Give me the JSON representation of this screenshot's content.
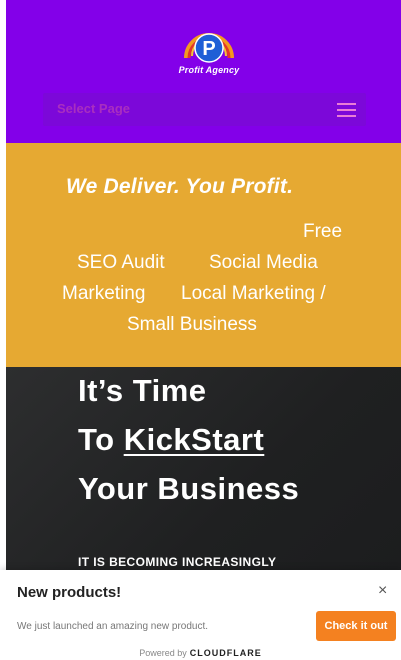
{
  "header": {
    "logo_text": "Profit Agency",
    "logo_letter": "P",
    "menu_placeholder": "Select Page"
  },
  "hero_band": {
    "tagline": "We Deliver. You Profit.",
    "services": [
      "Free",
      "SEO Audit",
      "Social Media",
      "Marketing",
      "Local Marketing /",
      "Small Business"
    ]
  },
  "hero": {
    "line1": "It’s Time",
    "line2_prefix": "To ",
    "line2_link": "KickStart",
    "line3": "Your Business",
    "subtext": "IT IS BECOMING INCREASINGLY"
  },
  "notification": {
    "title": "New products!",
    "message": "We just launched an amazing new product.",
    "cta_label": "Check it out",
    "close_glyph": "×",
    "powered_by": "Powered by",
    "brand": "CLOUDFLARE"
  },
  "colors": {
    "header_bg": "#8300e9",
    "band_gold": "#e6a932",
    "hero_dark": "#1f2021",
    "cta_orange": "#f48120"
  }
}
